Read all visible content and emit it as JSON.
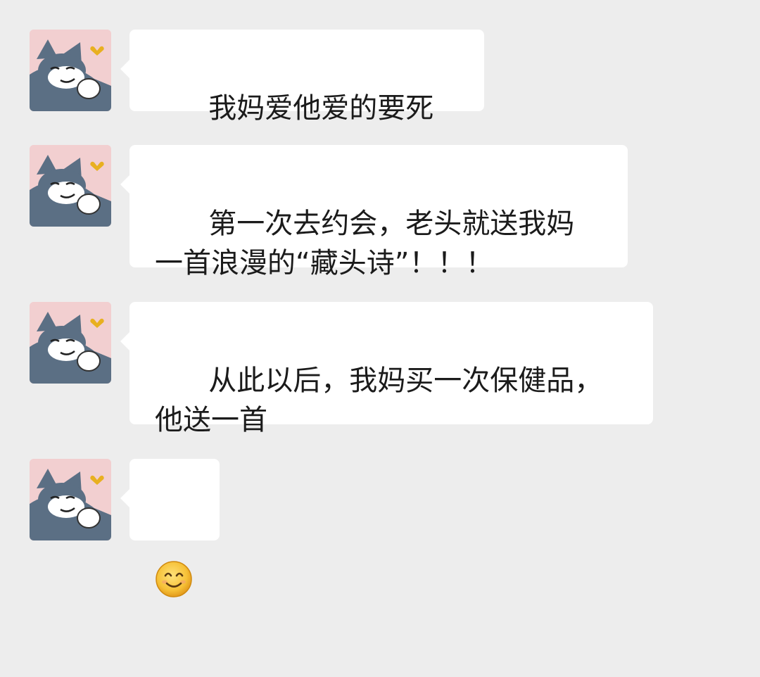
{
  "chat": {
    "messages": [
      {
        "sender": "avatar",
        "text": "我妈爱他爱的要死"
      },
      {
        "sender": "avatar",
        "text": "第一次去约会，老头就送我妈\n一首浪漫的“藏头诗”！！！"
      },
      {
        "sender": "avatar",
        "text": "从此以后，我妈买一次保健品，\n他送一首"
      },
      {
        "sender": "avatar",
        "emoji": "smiling-face"
      }
    ]
  },
  "colors": {
    "background": "#ededed",
    "bubble": "#ffffff",
    "text": "#1b1b1b",
    "avatar_bg": "#f2cfd0",
    "cat_fur": "#5b6f84",
    "emoji_face": "#f6c137"
  }
}
